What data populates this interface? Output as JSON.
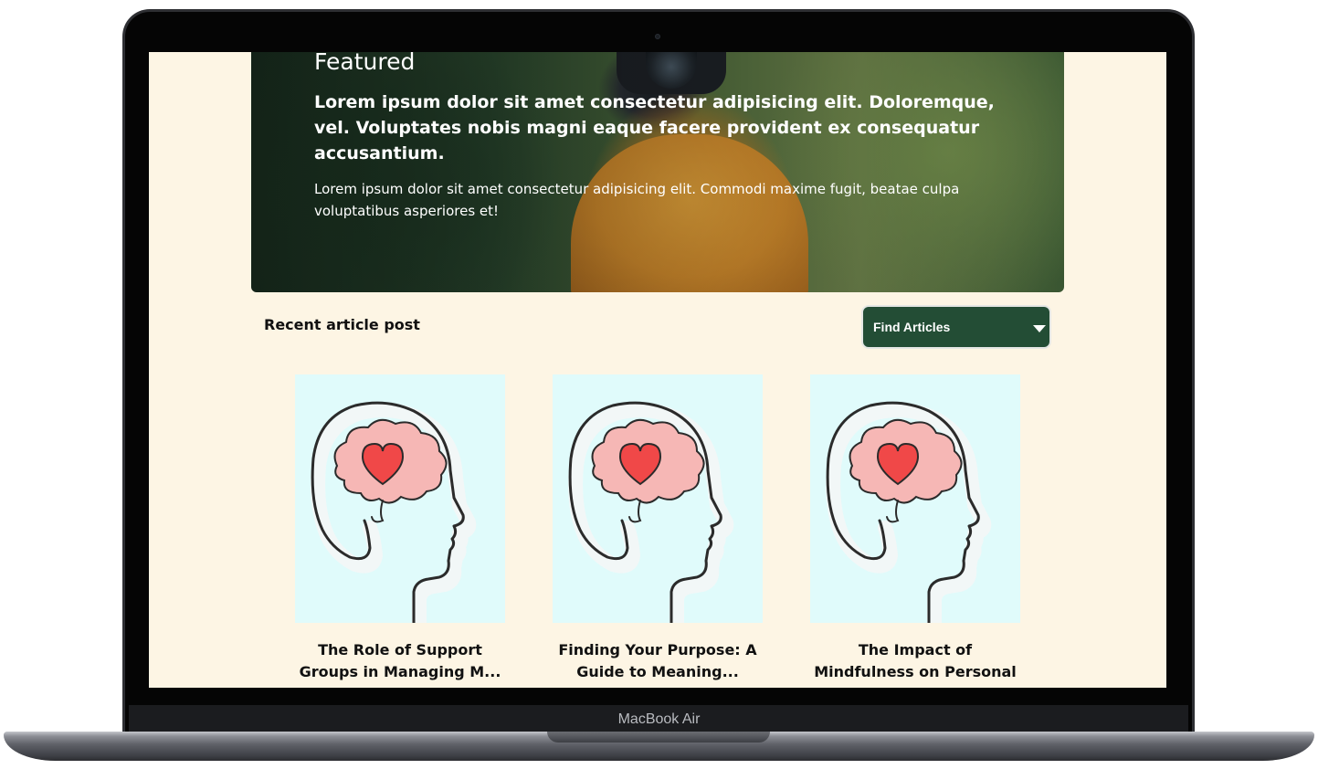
{
  "device": {
    "label": "MacBook Air"
  },
  "hero": {
    "section_label": "Featured",
    "title": "Lorem ipsum dolor sit amet consectetur adipisicing elit. Doloremque, vel. Voluptates nobis magni eaque facere provident ex consequatur accusantium.",
    "description": "Lorem ipsum dolor sit amet consectetur adipisicing elit. Commodi maxime fugit, beatae culpa voluptatibus asperiores et!"
  },
  "recent": {
    "heading": "Recent article post",
    "filter": {
      "label": "Find Articles",
      "icon": "chevron-down-icon"
    }
  },
  "articles": [
    {
      "title": "The Role of Support Groups in Managing M...",
      "image_icon": "head-brain-heart-illustration"
    },
    {
      "title": "Finding Your Purpose: A Guide to Meaning...",
      "image_icon": "head-brain-heart-illustration"
    },
    {
      "title": "The Impact of Mindfulness on Personal Gr...",
      "image_icon": "head-brain-heart-illustration"
    }
  ],
  "colors": {
    "page_background": "#fdf5e4",
    "accent": "#234d35",
    "card_background": "#e0fbfb",
    "brain": "#f6b7b5",
    "heart": "#f04848"
  }
}
